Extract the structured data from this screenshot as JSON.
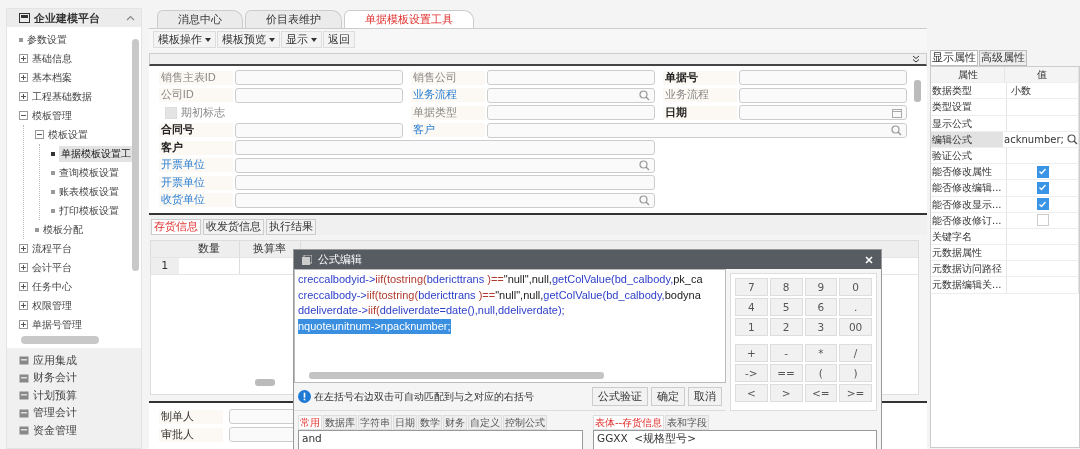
{
  "sidebar": {
    "title": "企业建模平台",
    "expanded": true,
    "tree": [
      {
        "label": "参数设置"
      },
      {
        "label": "基础信息",
        "expanded": false
      },
      {
        "label": "基本档案",
        "expanded": false
      },
      {
        "label": "工程基础数据",
        "expanded": false
      },
      {
        "label": "模板管理",
        "expanded": true,
        "children": [
          {
            "label": "模板设置",
            "expanded": true,
            "children": [
              {
                "label": "单据模板设置工",
                "selected": true
              },
              {
                "label": "查询模板设置",
                "selected": false
              },
              {
                "label": "账表模板设置",
                "selected": false
              },
              {
                "label": "打印模板设置",
                "selected": false
              }
            ]
          },
          {
            "label": "模板分配"
          }
        ]
      },
      {
        "label": "流程平台",
        "expanded": false
      },
      {
        "label": "会计平台",
        "expanded": false
      },
      {
        "label": "任务中心",
        "expanded": false
      },
      {
        "label": "权限管理",
        "expanded": false
      },
      {
        "label": "单据号管理",
        "expanded": false
      }
    ],
    "modules": [
      "应用集成",
      "财务会计",
      "计划预算",
      "管理会计",
      "资金管理"
    ]
  },
  "tabs": [
    {
      "label": "消息中心",
      "selected": false
    },
    {
      "label": "价目表维护",
      "selected": false
    },
    {
      "label": "单据模板设置工具",
      "selected": true
    }
  ],
  "toolbar": [
    {
      "label": "模板操作",
      "dropdown": true
    },
    {
      "label": "模板预览",
      "dropdown": true
    },
    {
      "label": "显示",
      "dropdown": true
    },
    {
      "label": "返回",
      "dropdown": false
    }
  ],
  "header_form": [
    [
      {
        "label": "销售主表ID",
        "disabled": true,
        "link": false,
        "kind": "plain"
      },
      {
        "label": "销售公司",
        "disabled": true,
        "link": false,
        "kind": "plain"
      },
      {
        "label": "单据号",
        "disabled": false,
        "link": false,
        "kind": "plain"
      }
    ],
    [
      {
        "label": "公司ID",
        "disabled": true,
        "link": false,
        "kind": "plain"
      },
      {
        "label": "业务流程",
        "disabled": false,
        "link": true,
        "kind": "search"
      },
      {
        "label": "业务流程",
        "disabled": true,
        "link": false,
        "kind": "plain"
      }
    ],
    [
      {
        "label": "期初标志",
        "disabled": true,
        "link": false,
        "kind": "checkbox",
        "checked": false
      },
      {
        "label": "单据类型",
        "disabled": true,
        "link": false,
        "kind": "plain"
      },
      {
        "label": "日期",
        "disabled": false,
        "link": false,
        "kind": "date"
      }
    ],
    [
      {
        "label": "合同号",
        "disabled": false,
        "link": false,
        "kind": "plain"
      },
      {
        "label": "客户",
        "disabled": false,
        "link": true,
        "kind": "search"
      }
    ],
    [
      {
        "label": "客户",
        "disabled": false,
        "link": false,
        "kind": "plain"
      }
    ],
    [
      {
        "label": "开票单位",
        "disabled": false,
        "link": true,
        "kind": "search"
      }
    ],
    [
      {
        "label": "开票单位",
        "disabled": false,
        "link": true,
        "kind": "plain"
      }
    ],
    [
      {
        "label": "收货单位",
        "disabled": false,
        "link": true,
        "kind": "search"
      }
    ]
  ],
  "body_tabs": [
    {
      "label": "存货信息",
      "selected": true
    },
    {
      "label": "收发货信息",
      "selected": false
    },
    {
      "label": "执行结果",
      "selected": false
    }
  ],
  "grid": {
    "columns": [
      "数量",
      "换算率"
    ],
    "rows": [
      "1"
    ]
  },
  "footer_form": [
    {
      "label": "制单人"
    },
    {
      "label": "审批人"
    }
  ],
  "dialog": {
    "title": "公式编辑",
    "code": [
      {
        "selected": false,
        "segments": [
          {
            "text": "creccalbodyid->",
            "kind": "ident"
          },
          {
            "text": "iif(tostring(",
            "kind": "func"
          },
          {
            "text": "bdericttrans ",
            "kind": "ident"
          },
          {
            "text": ")==",
            "kind": "func"
          },
          {
            "text": "\"null\",null,",
            "kind": "plain"
          },
          {
            "text": "getColValue(",
            "kind": "ident"
          },
          {
            "text": "bd_calbody,",
            "kind": "ident"
          },
          {
            "text": "pk_ca",
            "kind": "plain"
          }
        ]
      },
      {
        "selected": false,
        "segments": [
          {
            "text": "creccalbody->",
            "kind": "ident"
          },
          {
            "text": "iif(tostring(",
            "kind": "func"
          },
          {
            "text": "bdericttrans ",
            "kind": "ident"
          },
          {
            "text": ")==",
            "kind": "func"
          },
          {
            "text": "\"null\",null,",
            "kind": "plain"
          },
          {
            "text": "getColValue(",
            "kind": "ident"
          },
          {
            "text": "bd_calbody,",
            "kind": "ident"
          },
          {
            "text": "bodyna",
            "kind": "plain"
          }
        ]
      },
      {
        "selected": false,
        "segments": [
          {
            "text": "ddeliverdate->",
            "kind": "ident"
          },
          {
            "text": "iif(",
            "kind": "func"
          },
          {
            "text": "ddeliverdate=date(),null,ddeliverdate);",
            "kind": "ident"
          }
        ]
      },
      {
        "selected": true,
        "segments": [
          {
            "text": "nquoteunitnum->npacknumber;",
            "kind": "ident"
          }
        ]
      }
    ],
    "hint": "在左括号右边双击可自动匹配到与之对应的右括号",
    "buttons": [
      "公式验证",
      "确定",
      "取消"
    ],
    "keypad": [
      [
        [
          "7",
          "8",
          "9",
          "0"
        ],
        [
          "4",
          "5",
          "6",
          "."
        ],
        [
          "1",
          "2",
          "3",
          "00"
        ]
      ],
      [
        [
          "+",
          "-",
          "*",
          "/"
        ],
        [
          "->",
          "==",
          "(",
          ")"
        ],
        [
          "<",
          ">",
          "<=",
          ">="
        ]
      ]
    ],
    "func_tabs": [
      {
        "label": "常用",
        "selected": true
      },
      {
        "label": "数据库",
        "selected": false
      },
      {
        "label": "字符串",
        "selected": false
      },
      {
        "label": "日期",
        "selected": false
      },
      {
        "label": "数学",
        "selected": false
      },
      {
        "label": "财务",
        "selected": false
      },
      {
        "label": "自定义",
        "selected": false
      },
      {
        "label": "控制公式",
        "selected": false
      }
    ],
    "func_list": [
      "and"
    ],
    "field_tabs": [
      {
        "label": "表体--存货信息",
        "selected": true
      },
      {
        "label": "表和字段",
        "selected": false
      }
    ],
    "field_list": [
      "GGXX  <规格型号>"
    ]
  },
  "properties": {
    "tabs": [
      {
        "label": "显示属性",
        "selected": true
      },
      {
        "label": "高级属性",
        "selected": false
      }
    ],
    "columns": [
      "属性",
      "值"
    ],
    "rows": [
      {
        "name": "数据类型",
        "kind": "text",
        "value": "小数",
        "selected": false
      },
      {
        "name": "类型设置",
        "kind": "text",
        "selected": false
      },
      {
        "name": "显示公式",
        "kind": "text",
        "selected": false
      },
      {
        "name": "编辑公式",
        "kind": "search",
        "value": "acknumber;",
        "selected": true
      },
      {
        "name": "验证公式",
        "kind": "text",
        "selected": false
      },
      {
        "name": "能否修改属性",
        "kind": "checkbox",
        "checked": true,
        "selected": false
      },
      {
        "name": "能否修改编辑...",
        "kind": "checkbox",
        "checked": true,
        "selected": false
      },
      {
        "name": "能否修改显示...",
        "kind": "checkbox",
        "checked": true,
        "selected": false
      },
      {
        "name": "能否修改修订...",
        "kind": "checkbox",
        "checked": false,
        "selected": false
      },
      {
        "name": "关键字名",
        "kind": "text",
        "selected": false
      },
      {
        "name": "元数据属性",
        "kind": "text",
        "selected": false
      },
      {
        "name": "元数据访问路径",
        "kind": "text",
        "selected": false
      },
      {
        "name": "元数据编辑关...",
        "kind": "text",
        "selected": false
      }
    ]
  }
}
